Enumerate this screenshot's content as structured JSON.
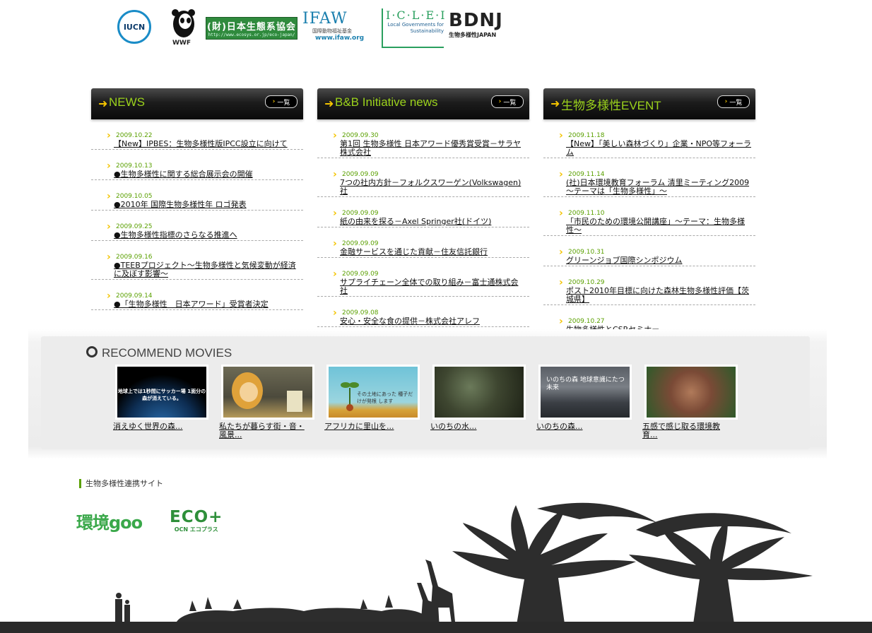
{
  "logos": {
    "iucn": "IUCN",
    "wwf": "WWF",
    "nacs_name": "(財)日本生態系協会",
    "nacs_url": "http://www.ecosys.or.jp/eco-japan/",
    "ifaw_name": "IFAW",
    "ifaw_sub": "国際動物福祉基金",
    "ifaw_url": "www.ifaw.org",
    "iclei_name": "I·C·L·E·I",
    "iclei_sub": "Local Governments for Sustainability",
    "bdnj_name": "BDNJ",
    "bdnj_sub": "生物多様性JAPAN"
  },
  "columns": [
    {
      "title": "NEWS",
      "all_label": "一覧",
      "items": [
        {
          "date": "2009.10.22",
          "title": "【New】IPBES：生物多様性版IPCC設立に向けて"
        },
        {
          "date": "2009.10.13",
          "title": "●生物多様性に関する総合展示会の開催"
        },
        {
          "date": "2009.10.05",
          "title": "●2010年 国際生物多様性年 ロゴ発表"
        },
        {
          "date": "2009.09.25",
          "title": "●生物多様性指標のさらなる推進へ"
        },
        {
          "date": "2009.09.16",
          "title": "●TEEBプロジェクト～生物多様性と気候変動が経済に及ぼす影響～"
        },
        {
          "date": "2009.09.14",
          "title": "●「生物多様性　日本アワード」受賞者決定"
        }
      ]
    },
    {
      "title": "B&B Initiative news",
      "all_label": "一覧",
      "items": [
        {
          "date": "2009.09.30",
          "title": "第1回 生物多様性 日本アワード優秀賞受賞－サラヤ株式会社"
        },
        {
          "date": "2009.09.09",
          "title": "7つの社内方針－フォルクスワーゲン(Volkswagen)社"
        },
        {
          "date": "2009.09.09",
          "title": "紙の由来を探る－Axel Springer社(ドイツ)"
        },
        {
          "date": "2009.09.09",
          "title": "金融サービスを通じた貢献－住友信託銀行"
        },
        {
          "date": "2009.09.09",
          "title": "サプライチェーン全体での取り組み－富士通株式会社"
        },
        {
          "date": "2009.09.08",
          "title": "安心・安全な食の提供－株式会社アレフ"
        }
      ]
    },
    {
      "title": "生物多様性EVENT",
      "all_label": "一覧",
      "items": [
        {
          "date": "2009.11.18",
          "title": "【New】「美しい森林づくり」企業・NPO等フォーラム"
        },
        {
          "date": "2009.11.14",
          "title": "(社)日本環境教育フォーラム 清里ミーティング2009 ～テーマは「生物多様性」～"
        },
        {
          "date": "2009.11.10",
          "title": "「市民のための環境公開講座」～テーマ：生物多様性～"
        },
        {
          "date": "2009.10.31",
          "title": "グリーンジョブ国際シンポジウム"
        },
        {
          "date": "2009.10.29",
          "title": "ポスト2010年目標に向けた森林生物多様性評価【茨城県】"
        },
        {
          "date": "2009.10.27",
          "title": "生物多様性とCSRセミナー"
        }
      ]
    }
  ],
  "movies": {
    "title": "RECOMMEND MOVIES",
    "items": [
      {
        "caption": "消えゆく世界の森...",
        "overlay": "地球上では1秒間にサッカー場 1面分の森が消えている。"
      },
      {
        "caption": "私たちが暮らす街・音・風景...",
        "overlay": ""
      },
      {
        "caption": "アフリカに里山を...",
        "overlay": "その土地にあった 種子だけが発根 します"
      },
      {
        "caption": "いのちの水...",
        "overlay": ""
      },
      {
        "caption": "いのちの森...",
        "overlay": "いのちの森 地球意識にたつ未来"
      },
      {
        "caption": "五感で感じ取る環境教育...",
        "overlay": ""
      }
    ]
  },
  "related": {
    "heading": "生物多様性連携サイト",
    "kankyo_goo": "環境goo",
    "ecoplus": "ECO+",
    "ecoplus_sub": "OCN エコプラス"
  }
}
